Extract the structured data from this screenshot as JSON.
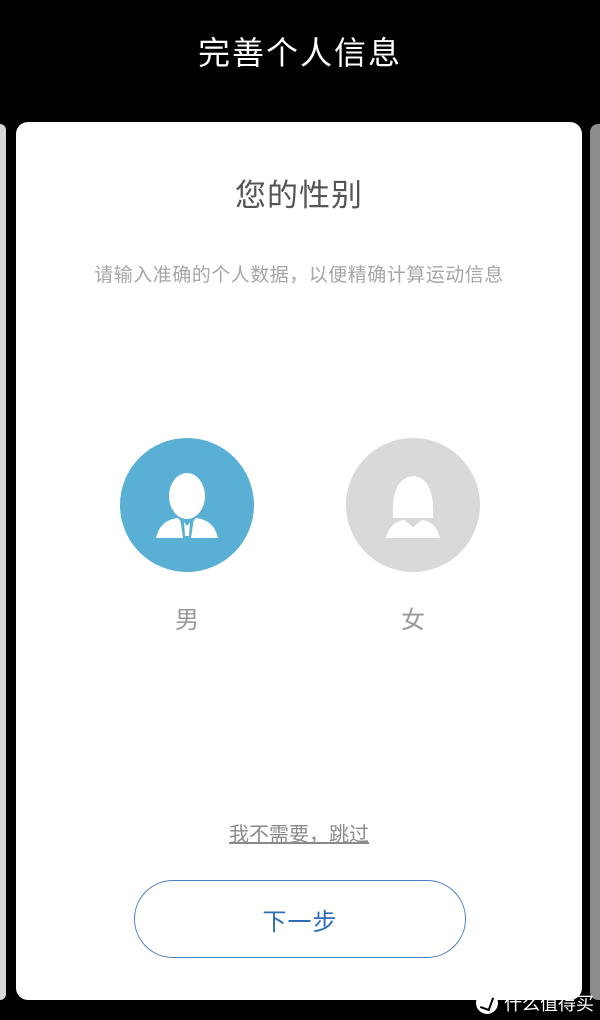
{
  "header": {
    "title": "完善个人信息"
  },
  "card": {
    "title": "您的性别",
    "subtitle": "请输入准确的个人数据，以便精确计算运动信息"
  },
  "gender": {
    "options": [
      {
        "label": "男",
        "icon": "male-avatar-icon",
        "selected": true,
        "color": "#5aafd5"
      },
      {
        "label": "女",
        "icon": "female-avatar-icon",
        "selected": false,
        "color": "#d9d9d9"
      }
    ]
  },
  "actions": {
    "skip_label": "我不需要，跳过",
    "next_label": "下一步"
  },
  "watermark": {
    "text": "什么值得买"
  },
  "colors": {
    "selected": "#5aafd5",
    "unselected": "#d9d9d9",
    "accent": "#2f6fb8",
    "background": "#000000"
  }
}
